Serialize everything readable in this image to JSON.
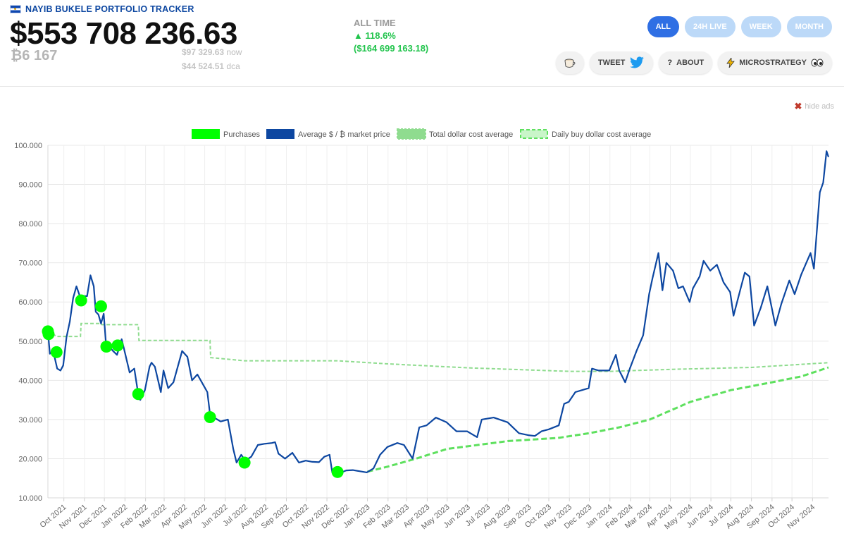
{
  "header": {
    "brand": "NAYIB BUKELE PORTFOLIO TRACKER",
    "portfolio_value": "$553 708 236.63",
    "btc_amount": "₿6 167",
    "price_now_value": "$97 329.63",
    "price_now_label": "now",
    "price_dca_value": "$44 524.51",
    "price_dca_label": "dca",
    "alltime_label": "ALL TIME",
    "alltime_pct": "▲ 118.6%",
    "alltime_gain": "($164 699 163.18)"
  },
  "range_tabs": [
    {
      "label": "ALL",
      "active": true
    },
    {
      "label": "24H LIVE",
      "active": false
    },
    {
      "label": "WEEK",
      "active": false
    },
    {
      "label": "MONTH",
      "active": false
    }
  ],
  "actions": {
    "tweet": "TWEET",
    "about": "ABOUT",
    "microstrategy": "MICROSTRATEGY"
  },
  "hide_ads": "hide ads",
  "colors": {
    "accent": "#2f6fe4",
    "pill_inactive": "#bcd9f8",
    "gain": "#21c44c",
    "price_line": "#0d47a1",
    "purchases": "#00ff00",
    "total_dca": "#8fdc8f",
    "daily_dca": "#5ee05e"
  },
  "icons": {
    "tweet": "twitter-bird-icon",
    "about": "question-icon",
    "microstrategy": "lightning-icon",
    "coffee": "coffee-cup-icon",
    "hide_ads": "close-icon"
  },
  "chart_data": {
    "type": "line",
    "legend_position": "top",
    "grid": true,
    "ylim": [
      10000,
      100000
    ],
    "yticks": [
      "100.000",
      "90.000",
      "80.000",
      "70.000",
      "60.000",
      "50.000",
      "40.000",
      "30.000",
      "20.000",
      "10.000"
    ],
    "xticks": [
      "Oct 2021",
      "Nov 2021",
      "Dec 2021",
      "Jan 2022",
      "Feb 2022",
      "Mar 2022",
      "Apr 2022",
      "May 2022",
      "Jun 2022",
      "Jul 2022",
      "Aug 2022",
      "Sep 2022",
      "Oct 2022",
      "Nov 2022",
      "Dec 2022",
      "Jan 2023",
      "Feb 2023",
      "Mar 2023",
      "Apr 2023",
      "May 2023",
      "Jun 2023",
      "Jul 2023",
      "Aug 2023",
      "Sep 2023",
      "Oct 2023",
      "Nov 2023",
      "Dec 2023",
      "Jan 2024",
      "Feb 2024",
      "Mar 2024",
      "Apr 2024",
      "May 2024",
      "Jun 2024",
      "Jul 2024",
      "Aug 2024",
      "Sep 2024",
      "Oct 2024",
      "Nov 2024"
    ],
    "legend": [
      "Purchases",
      "Average $ / ₿ market price",
      "Total dollar cost average",
      "Daily buy dollar cost average"
    ],
    "series": [
      {
        "name": "Average $ / ₿ market price",
        "points": [
          [
            "2021-09-07",
            52500
          ],
          [
            "2021-09-10",
            46800
          ],
          [
            "2021-09-15",
            47500
          ],
          [
            "2021-09-21",
            43000
          ],
          [
            "2021-09-26",
            42500
          ],
          [
            "2021-09-30",
            43800
          ],
          [
            "2021-10-05",
            51000
          ],
          [
            "2021-10-10",
            55000
          ],
          [
            "2021-10-15",
            61000
          ],
          [
            "2021-10-20",
            64000
          ],
          [
            "2021-10-25",
            61500
          ],
          [
            "2021-10-30",
            61500
          ],
          [
            "2021-11-05",
            61500
          ],
          [
            "2021-11-10",
            66800
          ],
          [
            "2021-11-15",
            64000
          ],
          [
            "2021-11-18",
            57500
          ],
          [
            "2021-11-22",
            56800
          ],
          [
            "2021-11-26",
            54500
          ],
          [
            "2021-11-30",
            57000
          ],
          [
            "2021-12-04",
            48000
          ],
          [
            "2021-12-09",
            48500
          ],
          [
            "2021-12-14",
            47500
          ],
          [
            "2021-12-20",
            46500
          ],
          [
            "2021-12-27",
            50500
          ],
          [
            "2022-01-01",
            47000
          ],
          [
            "2022-01-08",
            42000
          ],
          [
            "2022-01-15",
            43000
          ],
          [
            "2022-01-21",
            36500
          ],
          [
            "2022-01-24",
            35000
          ],
          [
            "2022-01-31",
            37500
          ],
          [
            "2022-02-07",
            43500
          ],
          [
            "2022-02-10",
            44500
          ],
          [
            "2022-02-15",
            43500
          ],
          [
            "2022-02-24",
            37000
          ],
          [
            "2022-02-28",
            42500
          ],
          [
            "2022-03-07",
            38000
          ],
          [
            "2022-03-15",
            39500
          ],
          [
            "2022-03-28",
            47500
          ],
          [
            "2022-04-05",
            46000
          ],
          [
            "2022-04-12",
            40000
          ],
          [
            "2022-04-20",
            41500
          ],
          [
            "2022-04-30",
            38500
          ],
          [
            "2022-05-05",
            37000
          ],
          [
            "2022-05-10",
            30000
          ],
          [
            "2022-05-15",
            30500
          ],
          [
            "2022-05-25",
            29500
          ],
          [
            "2022-06-05",
            30000
          ],
          [
            "2022-06-13",
            22500
          ],
          [
            "2022-06-18",
            19000
          ],
          [
            "2022-06-25",
            21000
          ],
          [
            "2022-07-01",
            19500
          ],
          [
            "2022-07-10",
            20500
          ],
          [
            "2022-07-20",
            23500
          ],
          [
            "2022-07-30",
            23800
          ],
          [
            "2022-08-10",
            24000
          ],
          [
            "2022-08-15",
            24200
          ],
          [
            "2022-08-20",
            21300
          ],
          [
            "2022-08-30",
            20000
          ],
          [
            "2022-09-10",
            21500
          ],
          [
            "2022-09-20",
            19000
          ],
          [
            "2022-09-30",
            19500
          ],
          [
            "2022-10-10",
            19200
          ],
          [
            "2022-10-20",
            19100
          ],
          [
            "2022-10-28",
            20500
          ],
          [
            "2022-11-05",
            21000
          ],
          [
            "2022-11-09",
            16500
          ],
          [
            "2022-11-20",
            16300
          ],
          [
            "2022-11-30",
            17000
          ],
          [
            "2022-12-10",
            17100
          ],
          [
            "2022-12-20",
            16800
          ],
          [
            "2022-12-31",
            16500
          ],
          [
            "2023-01-10",
            17500
          ],
          [
            "2023-01-20",
            21000
          ],
          [
            "2023-01-31",
            23000
          ],
          [
            "2023-02-15",
            24000
          ],
          [
            "2023-02-25",
            23500
          ],
          [
            "2023-03-10",
            20000
          ],
          [
            "2023-03-20",
            28000
          ],
          [
            "2023-03-31",
            28500
          ],
          [
            "2023-04-14",
            30500
          ],
          [
            "2023-04-30",
            29300
          ],
          [
            "2023-05-15",
            27000
          ],
          [
            "2023-05-31",
            27000
          ],
          [
            "2023-06-15",
            25500
          ],
          [
            "2023-06-22",
            30000
          ],
          [
            "2023-07-10",
            30500
          ],
          [
            "2023-07-31",
            29300
          ],
          [
            "2023-08-17",
            26500
          ],
          [
            "2023-08-31",
            26000
          ],
          [
            "2023-09-10",
            25800
          ],
          [
            "2023-09-20",
            27000
          ],
          [
            "2023-10-01",
            27500
          ],
          [
            "2023-10-16",
            28500
          ],
          [
            "2023-10-24",
            34000
          ],
          [
            "2023-10-31",
            34500
          ],
          [
            "2023-11-10",
            37000
          ],
          [
            "2023-11-20",
            37500
          ],
          [
            "2023-11-30",
            38000
          ],
          [
            "2023-12-05",
            43000
          ],
          [
            "2023-12-15",
            42500
          ],
          [
            "2023-12-31",
            42500
          ],
          [
            "2024-01-10",
            46500
          ],
          [
            "2024-01-15",
            42500
          ],
          [
            "2024-01-24",
            39500
          ],
          [
            "2024-01-31",
            43000
          ],
          [
            "2024-02-10",
            47500
          ],
          [
            "2024-02-20",
            51500
          ],
          [
            "2024-02-29",
            62000
          ],
          [
            "2024-03-05",
            66000
          ],
          [
            "2024-03-14",
            72500
          ],
          [
            "2024-03-20",
            63000
          ],
          [
            "2024-03-26",
            70000
          ],
          [
            "2024-04-05",
            68000
          ],
          [
            "2024-04-13",
            63500
          ],
          [
            "2024-04-20",
            64000
          ],
          [
            "2024-04-30",
            60000
          ],
          [
            "2024-05-05",
            63500
          ],
          [
            "2024-05-15",
            66500
          ],
          [
            "2024-05-21",
            70500
          ],
          [
            "2024-05-31",
            68000
          ],
          [
            "2024-06-10",
            69500
          ],
          [
            "2024-06-20",
            65000
          ],
          [
            "2024-06-30",
            62500
          ],
          [
            "2024-07-05",
            56500
          ],
          [
            "2024-07-15",
            63000
          ],
          [
            "2024-07-22",
            67500
          ],
          [
            "2024-07-29",
            66500
          ],
          [
            "2024-08-05",
            54000
          ],
          [
            "2024-08-15",
            58500
          ],
          [
            "2024-08-25",
            64000
          ],
          [
            "2024-08-31",
            59000
          ],
          [
            "2024-09-06",
            54000
          ],
          [
            "2024-09-15",
            59500
          ],
          [
            "2024-09-27",
            65500
          ],
          [
            "2024-10-05",
            62000
          ],
          [
            "2024-10-15",
            67000
          ],
          [
            "2024-10-29",
            72500
          ],
          [
            "2024-11-03",
            68500
          ],
          [
            "2024-11-06",
            75000
          ],
          [
            "2024-11-12",
            88000
          ],
          [
            "2024-11-17",
            90500
          ],
          [
            "2024-11-22",
            98500
          ],
          [
            "2024-11-25",
            97000
          ]
        ]
      },
      {
        "name": "Total dollar cost average",
        "points": [
          [
            "2021-09-07",
            52700
          ],
          [
            "2021-09-20",
            51200
          ],
          [
            "2021-10-26",
            51200
          ],
          [
            "2021-10-27",
            54500
          ],
          [
            "2021-11-26",
            54500
          ],
          [
            "2021-11-27",
            54200
          ],
          [
            "2022-01-21",
            54200
          ],
          [
            "2022-01-22",
            50200
          ],
          [
            "2022-05-09",
            50200
          ],
          [
            "2022-05-10",
            45800
          ],
          [
            "2022-06-30",
            45000
          ],
          [
            "2022-11-17",
            45000
          ],
          [
            "2023-02-01",
            44200
          ],
          [
            "2023-06-01",
            43200
          ],
          [
            "2023-11-01",
            42300
          ],
          [
            "2024-01-01",
            42300
          ],
          [
            "2024-04-01",
            42800
          ],
          [
            "2024-08-01",
            43300
          ],
          [
            "2024-11-25",
            44500
          ]
        ]
      },
      {
        "name": "Daily buy dollar cost average",
        "points": [
          [
            "2023-01-01",
            16700
          ],
          [
            "2023-02-01",
            18000
          ],
          [
            "2023-03-15",
            20000
          ],
          [
            "2023-05-01",
            22500
          ],
          [
            "2023-08-01",
            24500
          ],
          [
            "2023-10-15",
            25300
          ],
          [
            "2023-12-01",
            26500
          ],
          [
            "2024-01-15",
            28000
          ],
          [
            "2024-03-01",
            30000
          ],
          [
            "2024-05-01",
            34500
          ],
          [
            "2024-07-01",
            37500
          ],
          [
            "2024-09-01",
            39500
          ],
          [
            "2024-10-15",
            41000
          ],
          [
            "2024-11-25",
            43300
          ]
        ]
      },
      {
        "name": "Purchases",
        "points": [
          [
            "2021-09-07",
            52500
          ],
          [
            "2021-09-08",
            51800
          ],
          [
            "2021-09-20",
            47200
          ],
          [
            "2021-10-27",
            60400
          ],
          [
            "2021-11-26",
            58900
          ],
          [
            "2021-12-04",
            48600
          ],
          [
            "2021-12-21",
            48900
          ],
          [
            "2022-01-21",
            36500
          ],
          [
            "2022-05-09",
            30600
          ],
          [
            "2022-06-30",
            19000
          ],
          [
            "2022-11-17",
            16600
          ]
        ]
      }
    ]
  }
}
